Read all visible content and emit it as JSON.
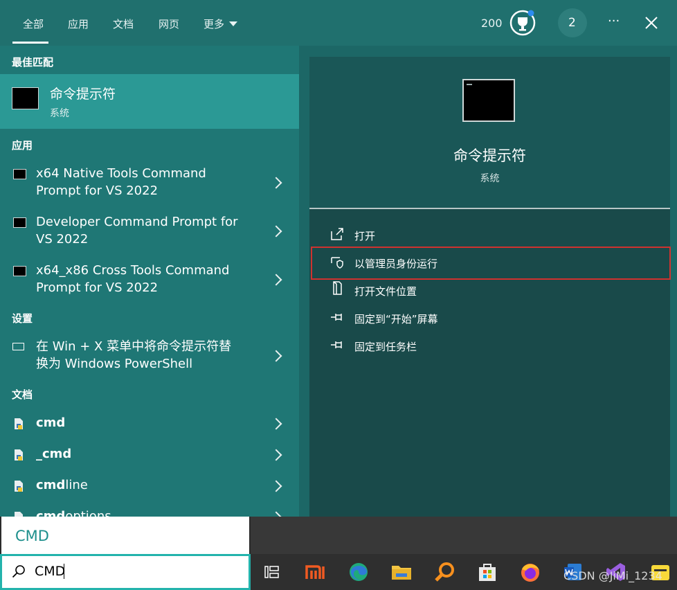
{
  "tabs": [
    {
      "label": "全部",
      "active": true
    },
    {
      "label": "应用"
    },
    {
      "label": "文档"
    },
    {
      "label": "网页"
    },
    {
      "label": "更多"
    }
  ],
  "header": {
    "points": "200",
    "badge_count": "2",
    "more_label": "···"
  },
  "sections": {
    "best_match": "最佳匹配",
    "apps": "应用",
    "settings": "设置",
    "docs": "文档"
  },
  "best_match": {
    "title": "命令提示符",
    "subtitle": "系统"
  },
  "apps": [
    {
      "line1": "x64 Native Tools Command",
      "line2": "Prompt for VS 2022"
    },
    {
      "line1": "Developer Command Prompt for",
      "line2": "VS 2022"
    },
    {
      "line1": "x64_x86 Cross Tools Command",
      "line2": "Prompt for VS 2022"
    }
  ],
  "settings": [
    {
      "line1": "在 Win + X 菜单中将命令提示符替",
      "line2": "换为 Windows PowerShell"
    }
  ],
  "docs": [
    {
      "bold": "cmd",
      "rest": ""
    },
    {
      "bold": "_cmd",
      "rest": ""
    },
    {
      "bold": "cmd",
      "rest": "line"
    },
    {
      "bold": "cmd",
      "rest": "options"
    }
  ],
  "preview": {
    "title": "命令提示符",
    "subtitle": "系统"
  },
  "actions": [
    {
      "label": "打开",
      "icon": "open-icon"
    },
    {
      "label": "以管理员身份运行",
      "icon": "shield-icon"
    },
    {
      "label": "打开文件位置",
      "icon": "file-location-icon"
    },
    {
      "label": "固定到“开始”屏幕",
      "icon": "pin-icon"
    },
    {
      "label": "固定到任务栏",
      "icon": "pin-icon"
    }
  ],
  "autocomplete": "CMD",
  "search": {
    "value": "CMD"
  },
  "watermark": "CSDN @JiMi_1234",
  "colors": {
    "accent": "#1f7775",
    "highlight": "#d0322f",
    "search_border": "#23b3ac"
  }
}
